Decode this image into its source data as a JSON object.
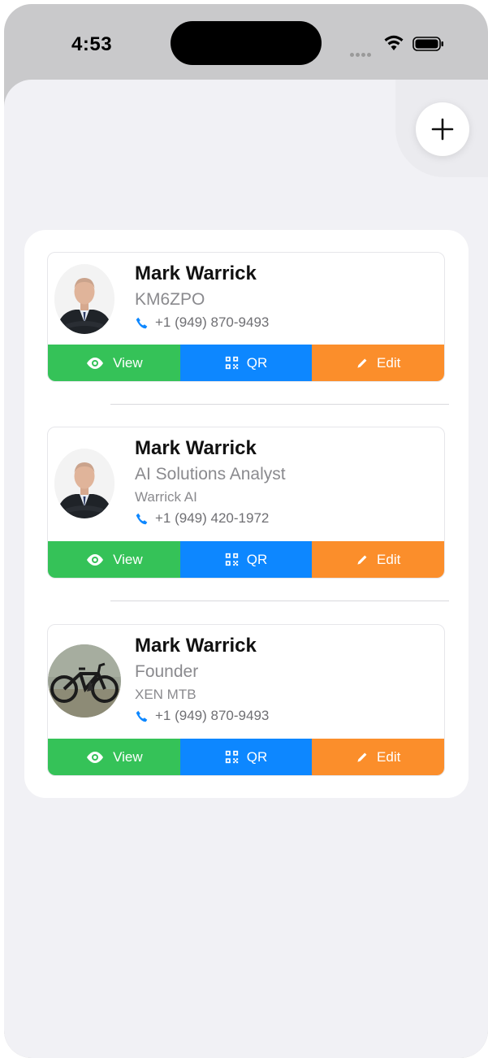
{
  "status_bar": {
    "time": "4:53"
  },
  "add_button": {
    "icon": "plus-icon"
  },
  "cards": [
    {
      "name": "Mark Warrick",
      "title": "KM6ZPO",
      "company": "",
      "phone": "+1 (949) 870-9493",
      "avatar": "portrait-suit",
      "actions": {
        "view": "View",
        "qr": "QR",
        "edit": "Edit"
      }
    },
    {
      "name": "Mark Warrick",
      "title": "AI Solutions Analyst",
      "company": "Warrick AI",
      "phone": "+1 (949) 420-1972",
      "avatar": "portrait-suit",
      "actions": {
        "view": "View",
        "qr": "QR",
        "edit": "Edit"
      }
    },
    {
      "name": "Mark Warrick",
      "title": "Founder",
      "company": "XEN MTB",
      "phone": "+1 (949) 870-9493",
      "avatar": "mountain-bike-photo",
      "actions": {
        "view": "View",
        "qr": "QR",
        "edit": "Edit"
      }
    }
  ],
  "colors": {
    "view": "#35c258",
    "qr": "#0d87ff",
    "edit": "#fb8e2b",
    "phone_icon": "#0d87ff",
    "background": "#f1f1f5"
  }
}
